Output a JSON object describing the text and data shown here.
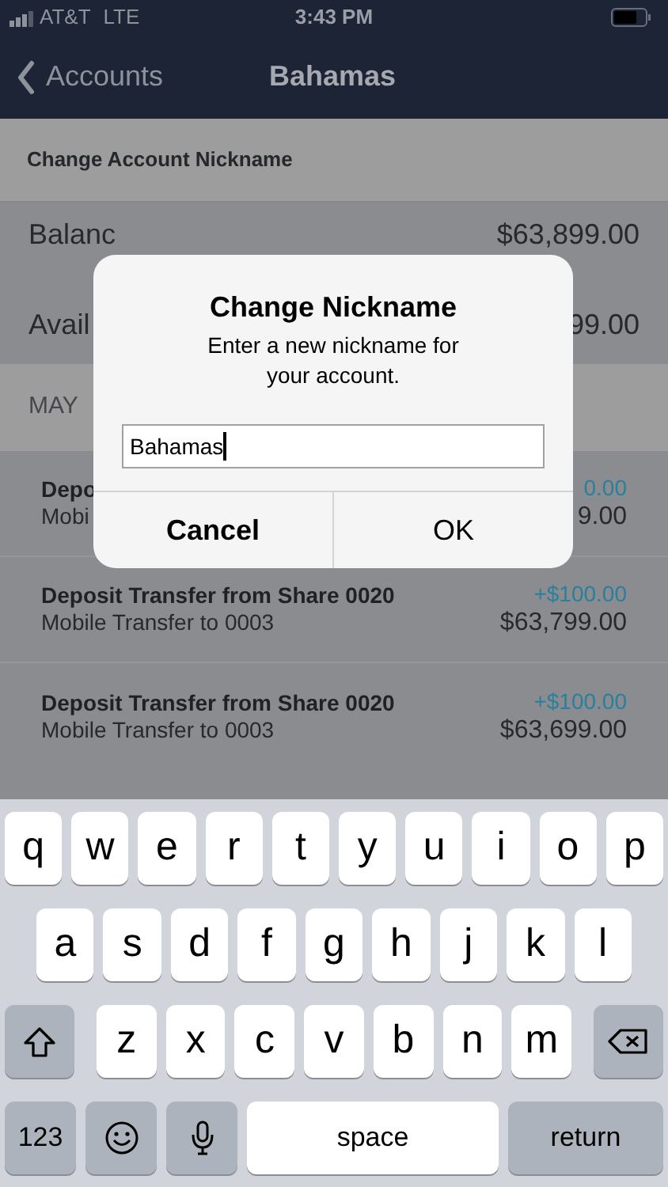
{
  "status_bar": {
    "carrier": "AT&T",
    "network": "LTE",
    "time": "3:43 PM"
  },
  "nav": {
    "back_label": "Accounts",
    "title": "Bahamas"
  },
  "section_header": "Change Account Nickname",
  "summary": [
    {
      "label": "Balanc",
      "value": "$63,899.00"
    },
    {
      "label": "Avail",
      "value": "99.00"
    }
  ],
  "date_header": "MAY",
  "transactions": [
    {
      "title": "Depo",
      "subtitle": "Mobi",
      "amount": "0.00",
      "balance": "9.00"
    },
    {
      "title": "Deposit Transfer from Share 0020",
      "subtitle": "Mobile Transfer to 0003",
      "amount": "+$100.00",
      "balance": "$63,799.00"
    },
    {
      "title": "Deposit Transfer from Share 0020",
      "subtitle": "Mobile Transfer to 0003",
      "amount": "+$100.00",
      "balance": "$63,699.00"
    }
  ],
  "dialog": {
    "title": "Change Nickname",
    "message": "Enter a new nickname for your account.",
    "field_value": "Bahamas",
    "buttons": [
      {
        "label": "Cancel",
        "emphasized": true
      },
      {
        "label": "OK",
        "emphasized": false
      }
    ]
  },
  "keyboard": [
    [
      {
        "kind": "letter",
        "label": "q"
      },
      {
        "kind": "letter",
        "label": "w"
      },
      {
        "kind": "letter",
        "label": "e"
      },
      {
        "kind": "letter",
        "label": "r"
      },
      {
        "kind": "letter",
        "label": "t"
      },
      {
        "kind": "letter",
        "label": "y"
      },
      {
        "kind": "letter",
        "label": "u"
      },
      {
        "kind": "letter",
        "label": "i"
      },
      {
        "kind": "letter",
        "label": "o"
      },
      {
        "kind": "letter",
        "label": "p"
      }
    ],
    [
      {
        "kind": "letter",
        "label": "a"
      },
      {
        "kind": "letter",
        "label": "s"
      },
      {
        "kind": "letter",
        "label": "d"
      },
      {
        "kind": "letter",
        "label": "f"
      },
      {
        "kind": "letter",
        "label": "g"
      },
      {
        "kind": "letter",
        "label": "h"
      },
      {
        "kind": "letter",
        "label": "j"
      },
      {
        "kind": "letter",
        "label": "k"
      },
      {
        "kind": "letter",
        "label": "l"
      }
    ],
    [
      {
        "kind": "shift"
      },
      {
        "kind": "letter",
        "label": "z"
      },
      {
        "kind": "letter",
        "label": "x"
      },
      {
        "kind": "letter",
        "label": "c"
      },
      {
        "kind": "letter",
        "label": "v"
      },
      {
        "kind": "letter",
        "label": "b"
      },
      {
        "kind": "letter",
        "label": "n"
      },
      {
        "kind": "letter",
        "label": "m"
      },
      {
        "kind": "delete"
      }
    ],
    [
      {
        "kind": "numbers",
        "label": "123"
      },
      {
        "kind": "emoji"
      },
      {
        "kind": "mic"
      },
      {
        "kind": "space",
        "label": "space"
      },
      {
        "kind": "return",
        "label": "return"
      }
    ]
  ]
}
